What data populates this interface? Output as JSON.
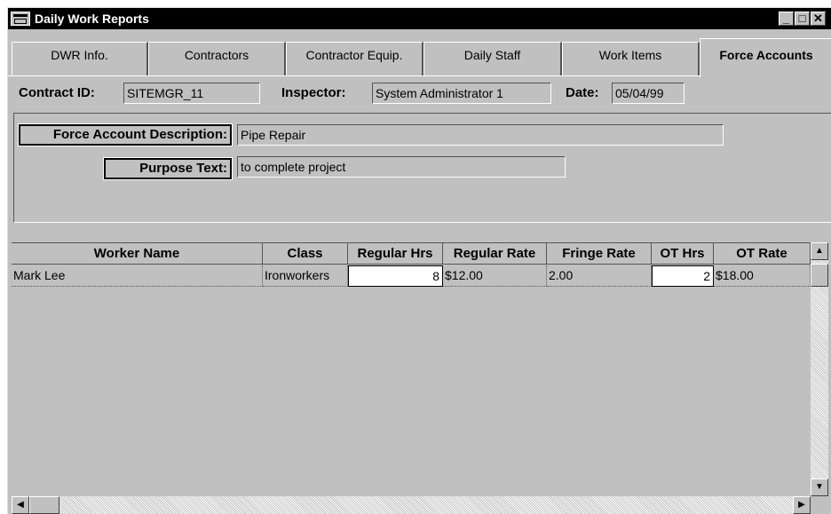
{
  "window": {
    "title": "Daily Work Reports"
  },
  "tabs": [
    {
      "label": "DWR Info."
    },
    {
      "label": "Contractors"
    },
    {
      "label": "Contractor Equip."
    },
    {
      "label": "Daily Staff"
    },
    {
      "label": "Work Items"
    },
    {
      "label": "Force Accounts",
      "active": true
    }
  ],
  "header": {
    "contract_id_label": "Contract ID:",
    "contract_id_value": "SITEMGR_11",
    "inspector_label": "Inspector:",
    "inspector_value": "System Administrator 1",
    "date_label": "Date:",
    "date_value": "05/04/99"
  },
  "force_account": {
    "description_label": "Force Account Description:",
    "description_value": "Pipe Repair",
    "purpose_label": "Purpose Text:",
    "purpose_value": "to complete project"
  },
  "grid": {
    "columns": [
      "Worker Name",
      "Class",
      "Regular Hrs",
      "Regular Rate",
      "Fringe Rate",
      "OT Hrs",
      "OT Rate"
    ],
    "rows": [
      [
        "Mark Lee",
        "Ironworkers",
        "8",
        "$12.00",
        "2.00",
        "2",
        "$18.00"
      ]
    ]
  },
  "scroll": {
    "up": "▲",
    "down": "▼",
    "left": "◀",
    "right": "▶"
  },
  "title_buttons": {
    "minimize": "_",
    "maximize": "□",
    "close": "✕"
  }
}
